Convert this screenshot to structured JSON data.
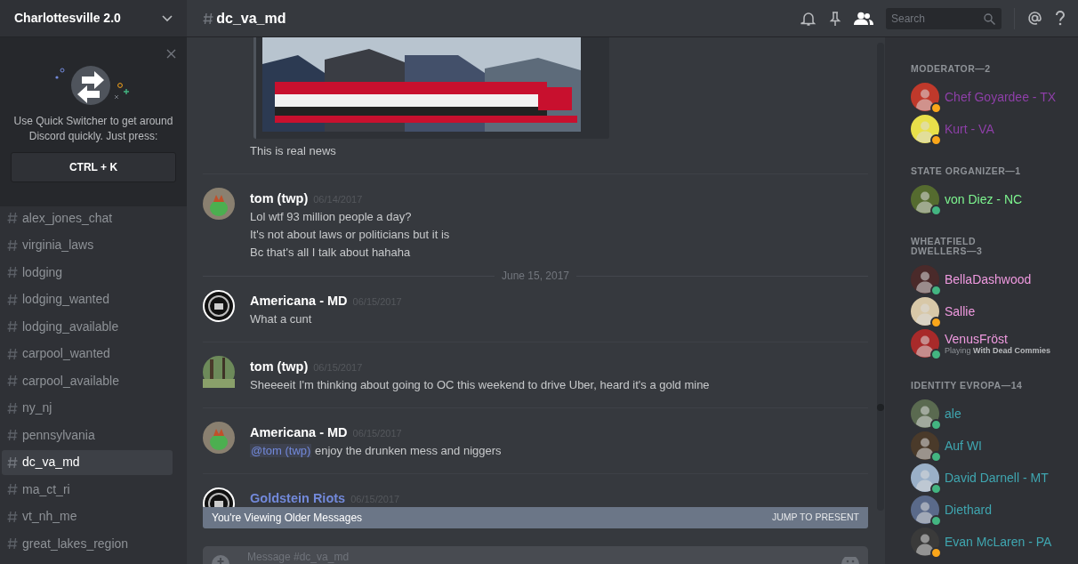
{
  "server": {
    "name": "Charlottesville 2.0"
  },
  "quick_switcher": {
    "text": "Use Quick Switcher to get around Discord quickly. Just press:",
    "shortcut": "CTRL + K"
  },
  "channels": [
    {
      "name": "alex_jones_chat",
      "selected": false
    },
    {
      "name": "virginia_laws",
      "selected": false
    },
    {
      "name": "lodging",
      "selected": false
    },
    {
      "name": "lodging_wanted",
      "selected": false
    },
    {
      "name": "lodging_available",
      "selected": false
    },
    {
      "name": "carpool_wanted",
      "selected": false
    },
    {
      "name": "carpool_available",
      "selected": false
    },
    {
      "name": "ny_nj",
      "selected": false
    },
    {
      "name": "pennsylvania",
      "selected": false
    },
    {
      "name": "dc_va_md",
      "selected": true
    },
    {
      "name": "ma_ct_ri",
      "selected": false
    },
    {
      "name": "vt_nh_me",
      "selected": false
    },
    {
      "name": "great_lakes_region",
      "selected": false
    }
  ],
  "header": {
    "channel": "dc_va_md",
    "search_placeholder": "Search"
  },
  "feed": [
    {
      "kind": "continuation",
      "embed": {
        "kind": "picture"
      },
      "lines": [
        "This is real news"
      ]
    },
    {
      "kind": "message",
      "author": "tom (twp)",
      "time": "06/14/2017",
      "lines": [
        "Lol wtf 93 million people a day?",
        "It's not about laws or politicians but it is",
        "Bc that's all I talk about hahaha"
      ]
    },
    {
      "kind": "date",
      "label": "June 15, 2017"
    },
    {
      "kind": "message",
      "author": "Americana - MD",
      "time": "06/15/2017",
      "lines": [
        "What a cunt"
      ]
    },
    {
      "kind": "message",
      "author": "tom (twp)",
      "time": "06/15/2017",
      "lines": [
        "Sheeeeit I'm thinking about going to OC this weekend to drive Uber, heard it's a gold mine"
      ]
    },
    {
      "kind": "message",
      "author": "Americana - MD",
      "time": "06/15/2017",
      "mention": "@tom (twp)",
      "lines": [
        "enjoy the drunken mess and niggers"
      ]
    },
    {
      "kind": "message",
      "author": "Goldstein Riots",
      "color": "#7289da",
      "time": "06/15/2017"
    }
  ],
  "older_banner": {
    "text": "You're Viewing Older Messages",
    "action": "JUMP TO PRESENT"
  },
  "composer": {
    "placeholder": "Message #dc_va_md"
  },
  "member_groups": [
    {
      "title": "MODERATOR—2",
      "color": "#8e3fa8",
      "members": [
        {
          "name": "Chef Goyardee - TX",
          "color": "#faa61a"
        },
        {
          "name": "Kurt - VA",
          "color": "#faa61a"
        }
      ]
    },
    {
      "title": "STATE ORGANIZER—1",
      "color": "#7df58f",
      "members": [
        {
          "name": "von Diez - NC",
          "color": "#43b581"
        }
      ]
    },
    {
      "title": "WHEATFIELD DWELLERS—3",
      "color": "#f09ae0",
      "members": [
        {
          "name": "BellaDashwood",
          "color": "#43b581"
        },
        {
          "name": "Sallie",
          "color": "#faa61a"
        },
        {
          "name": "VenusFröst",
          "color": "#43b581",
          "activity": "Playing **With Dead Commies**"
        }
      ]
    },
    {
      "title": "IDENTITY EVROPA—14",
      "color": "#3fa6b0",
      "members": [
        {
          "name": "ale",
          "color": "#43b581"
        },
        {
          "name": "Auf WI",
          "color": "#43b581"
        },
        {
          "name": "David Darnell - MT",
          "color": "#43b581"
        },
        {
          "name": "Diethard",
          "color": "#43b581"
        },
        {
          "name": "Evan McLaren - PA",
          "color": "#faa61a"
        }
      ]
    }
  ]
}
